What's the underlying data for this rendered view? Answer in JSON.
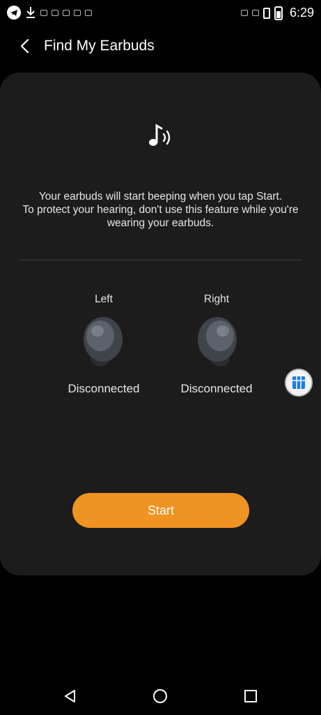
{
  "status_bar": {
    "time": "6:29",
    "icons_left": [
      "telegram-icon",
      "download-icon",
      "notification-icons"
    ],
    "icons_right": [
      "vibrate-icon",
      "battery-icon"
    ]
  },
  "header": {
    "title": "Find My Earbuds",
    "back_icon": "chevron-left-icon"
  },
  "card": {
    "icon": "music-note-sound-icon",
    "description": "Your earbuds will start beeping when you tap Start.\nTo protect your hearing, don't use this feature while you're wearing your earbuds.",
    "earbuds": [
      {
        "label": "Left",
        "status": "Disconnected"
      },
      {
        "label": "Right",
        "status": "Disconnected"
      }
    ],
    "start_label": "Start"
  },
  "floating_button": {
    "icon": "cube-icon"
  },
  "nav": {
    "back": "triangle-back-icon",
    "home": "circle-home-icon",
    "recents": "square-recents-icon"
  },
  "colors": {
    "accent": "#ef9322",
    "card": "#1c1c1c",
    "background": "#000000"
  }
}
